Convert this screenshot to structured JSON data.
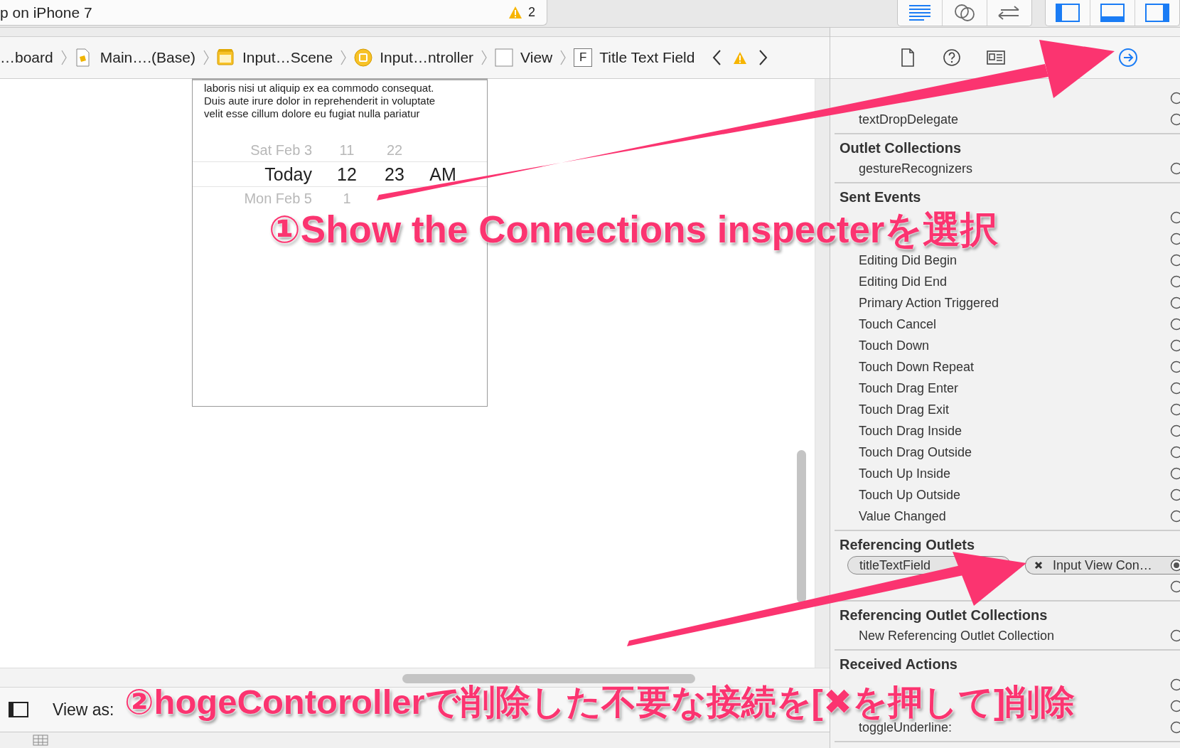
{
  "window": {
    "title": "p on iPhone 7",
    "warning_count": "2"
  },
  "editor_modes": [
    {
      "selected": true
    },
    {
      "selected": false
    },
    {
      "selected": false
    }
  ],
  "panels": [
    {
      "on": true
    },
    {
      "on": true
    },
    {
      "on": true
    }
  ],
  "breadcrumb": [
    {
      "kind": "plain",
      "label": "…board"
    },
    {
      "kind": "file",
      "label": "Main….(Base)"
    },
    {
      "kind": "scene",
      "label": "Input…Scene"
    },
    {
      "kind": "controller",
      "label": "Input…ntroller"
    },
    {
      "kind": "view",
      "label": "View"
    },
    {
      "kind": "field",
      "label": "Title Text Field",
      "glyph": "F"
    }
  ],
  "inspector_tabs": [
    {
      "selected": false
    },
    {
      "selected": false
    },
    {
      "selected": false
    },
    {
      "selected": true
    }
  ],
  "canvas": {
    "text_lines": [
      "laboris nisi ut aliquip ex ea commodo consequat.",
      "Duis aute irure dolor in reprehenderit in voluptate",
      "velit esse cillum dolore eu fugiat nulla pariatur"
    ],
    "picker_rows": [
      {
        "cells": [
          "Sat Feb 3",
          "11",
          "22"
        ],
        "selected": false
      },
      {
        "cells": [
          "Today",
          "12",
          "23",
          "AM"
        ],
        "selected": true
      },
      {
        "cells": [
          "Mon Feb 5",
          "1"
        ],
        "selected": false
      }
    ]
  },
  "bottom_bar": {
    "view_as_label": "View as:"
  },
  "connections": [
    {
      "items": [
        {
          "connected": false
        },
        {
          "label": "textDropDelegate",
          "connected": false
        }
      ]
    },
    {
      "title": "Outlet Collections",
      "items": [
        {
          "label": "gestureRecognizers",
          "connected": false
        }
      ]
    },
    {
      "title": "Sent Events",
      "items": [
        {
          "connected": false
        },
        {
          "connected": false
        },
        {
          "label": "Editing Did Begin",
          "connected": false
        },
        {
          "label": "Editing Did End",
          "connected": false
        },
        {
          "label": "Primary Action Triggered",
          "connected": false
        },
        {
          "label": "Touch Cancel",
          "connected": false
        },
        {
          "label": "Touch Down",
          "connected": false
        },
        {
          "label": "Touch Down Repeat",
          "connected": false
        },
        {
          "label": "Touch Drag Enter",
          "connected": false
        },
        {
          "label": "Touch Drag Exit",
          "connected": false
        },
        {
          "label": "Touch Drag Inside",
          "connected": false
        },
        {
          "label": "Touch Drag Outside",
          "connected": false
        },
        {
          "label": "Touch Up Inside",
          "connected": false
        },
        {
          "label": "Touch Up Outside",
          "connected": false
        },
        {
          "label": "Value Changed",
          "connected": false
        }
      ]
    },
    {
      "title": "Referencing Outlets",
      "items": [
        {
          "label": "titleTextField",
          "connected": true,
          "target": "Input View Con…"
        },
        {
          "connected": false
        }
      ]
    },
    {
      "title": "Referencing Outlet Collections",
      "items": [
        {
          "label": "New Referencing Outlet Collection",
          "connected": false
        }
      ]
    },
    {
      "title": "Received Actions",
      "items": [
        {
          "connected": false
        },
        {
          "connected": false
        },
        {
          "label": "toggleUnderline:",
          "connected": false
        }
      ]
    }
  ],
  "annotations": [
    {
      "text": "①Show the Connections inspecterを選択"
    },
    {
      "text": "②hogeContorollerで削除した不要な接続を[✖を押して]削除"
    }
  ]
}
